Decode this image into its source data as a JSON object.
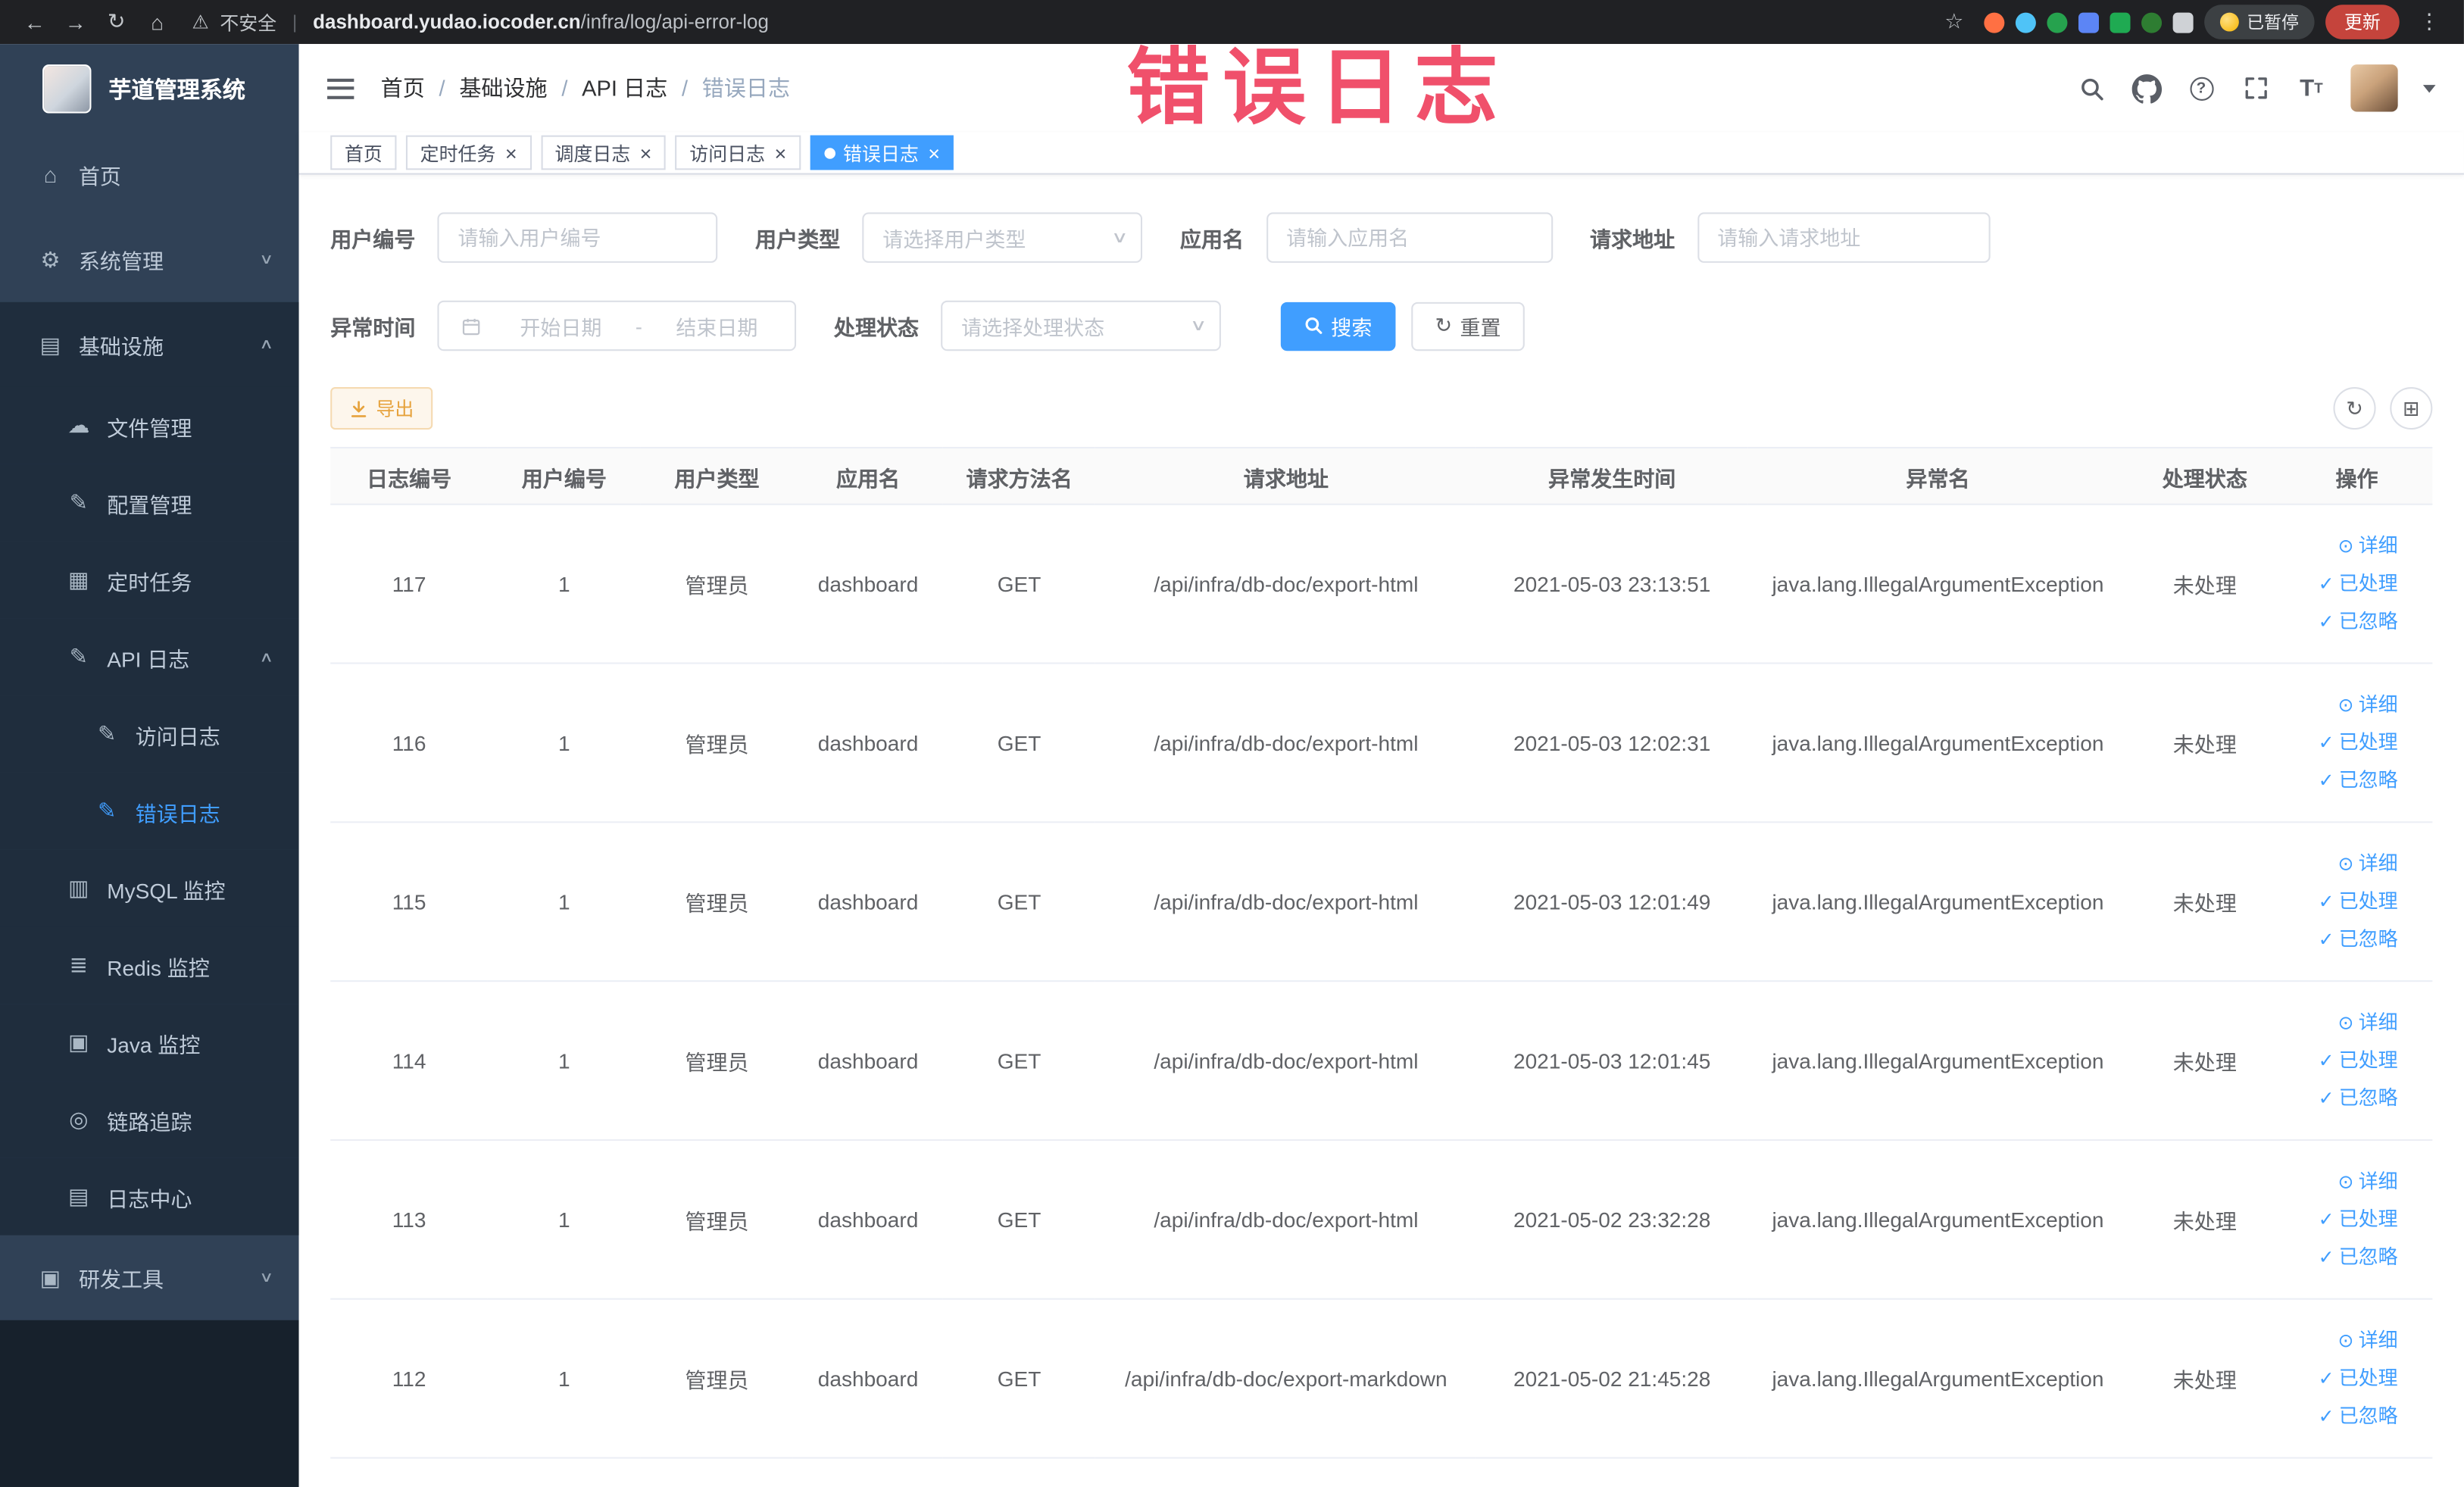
{
  "browser": {
    "security_label": "不安全",
    "url_separator": "|",
    "url_domain": "dashboard.yudao.iocoder.cn",
    "url_path": "/infra/log/api-error-log",
    "paused_badge": "已暂停",
    "update_button": "更新"
  },
  "annotation": {
    "title": "错误日志",
    "color": "#f0506b"
  },
  "icon_glyphs": {
    "back": "←",
    "forward": "→",
    "reload": "↻",
    "browser-home": "⌂",
    "star": "☆",
    "kebab": "⋮",
    "warning": "⚠",
    "home": "⌂",
    "gear": "⚙",
    "infra": "▤",
    "cloud": "☁",
    "edit": "✎",
    "task": "▦",
    "mysql": "▥",
    "redis": "≣",
    "java": "▣",
    "eye": "◎",
    "doc": "▤",
    "monitor": "▣",
    "chevron-up": "∧",
    "chevron-down": "∨",
    "close": "×",
    "refresh": "↻",
    "grid": "⊞",
    "eye-action": "⊙",
    "check": "✓"
  },
  "sidebar": {
    "logo_title": "芋道管理系统",
    "items": [
      {
        "key": "home",
        "label": "首页",
        "icon": "home",
        "level": 1
      },
      {
        "key": "system",
        "label": "系统管理",
        "icon": "gear",
        "level": 1,
        "arrow": "down"
      },
      {
        "key": "infrastructure",
        "label": "基础设施",
        "icon": "infra",
        "level": 1,
        "arrow": "up",
        "sub": true
      },
      {
        "key": "file-manage",
        "label": "文件管理",
        "icon": "cloud",
        "level": 2,
        "sub": true
      },
      {
        "key": "config-manage",
        "label": "配置管理",
        "icon": "edit",
        "level": 2,
        "sub": true
      },
      {
        "key": "scheduled-job",
        "label": "定时任务",
        "icon": "task",
        "level": 2,
        "sub": true
      },
      {
        "key": "api-log",
        "label": "API 日志",
        "icon": "edit",
        "level": 2,
        "arrow": "up",
        "sub": true
      },
      {
        "key": "access-log",
        "label": "访问日志",
        "icon": "edit",
        "level": 3,
        "sub": true
      },
      {
        "key": "error-log",
        "label": "错误日志",
        "icon": "edit",
        "level": 3,
        "sub": true,
        "active": true
      },
      {
        "key": "mysql-monitor",
        "label": "MySQL 监控",
        "icon": "mysql",
        "level": 2,
        "sub": true
      },
      {
        "key": "redis-monitor",
        "label": "Redis 监控",
        "icon": "redis",
        "level": 2,
        "sub": true
      },
      {
        "key": "java-monitor",
        "label": "Java 监控",
        "icon": "java",
        "level": 2,
        "sub": true
      },
      {
        "key": "trace",
        "label": "链路追踪",
        "icon": "eye",
        "level": 2,
        "sub": true
      },
      {
        "key": "log-center",
        "label": "日志中心",
        "icon": "doc",
        "level": 2,
        "sub": true
      },
      {
        "key": "dev-tools",
        "label": "研发工具",
        "icon": "monitor",
        "level": 1,
        "arrow": "down"
      }
    ]
  },
  "header": {
    "breadcrumb": [
      "首页",
      "基础设施",
      "API 日志",
      "错误日志"
    ],
    "breadcrumb_separator": "/"
  },
  "tabs": [
    {
      "key": "home",
      "label": "首页",
      "closable": false,
      "active": false
    },
    {
      "key": "scheduled-job",
      "label": "定时任务",
      "closable": true,
      "active": false
    },
    {
      "key": "job-log",
      "label": "调度日志",
      "closable": true,
      "active": false
    },
    {
      "key": "access-log",
      "label": "访问日志",
      "closable": true,
      "active": false
    },
    {
      "key": "error-log",
      "label": "错误日志",
      "closable": true,
      "active": true
    }
  ],
  "filters": {
    "user_id_label": "用户编号",
    "user_id_placeholder": "请输入用户编号",
    "user_type_label": "用户类型",
    "user_type_placeholder": "请选择用户类型",
    "app_name_label": "应用名",
    "app_name_placeholder": "请输入应用名",
    "request_url_label": "请求地址",
    "request_url_placeholder": "请输入请求地址",
    "exception_time_label": "异常时间",
    "start_date_placeholder": "开始日期",
    "range_separator": "-",
    "end_date_placeholder": "结束日期",
    "process_status_label": "处理状态",
    "process_status_placeholder": "请选择处理状态",
    "search_button": "搜索",
    "reset_button": "重置"
  },
  "toolbar": {
    "export_button": "导出"
  },
  "table": {
    "columns": [
      "日志编号",
      "用户编号",
      "用户类型",
      "应用名",
      "请求方法名",
      "请求地址",
      "异常发生时间",
      "异常名",
      "处理状态",
      "操作"
    ],
    "row_actions": [
      {
        "key": "detail",
        "label": "详细",
        "icon": "eye-action"
      },
      {
        "key": "processed",
        "label": "已处理",
        "icon": "check"
      },
      {
        "key": "ignored",
        "label": "已忽略",
        "icon": "check"
      }
    ],
    "rows": [
      {
        "id": "117",
        "user_id": "1",
        "user_type": "管理员",
        "app": "dashboard",
        "method": "GET",
        "url": "/api/infra/db-doc/export-html",
        "time": "2021-05-03 23:13:51",
        "exception": "java.lang.IllegalArgumentException",
        "status": "未处理"
      },
      {
        "id": "116",
        "user_id": "1",
        "user_type": "管理员",
        "app": "dashboard",
        "method": "GET",
        "url": "/api/infra/db-doc/export-html",
        "time": "2021-05-03 12:02:31",
        "exception": "java.lang.IllegalArgumentException",
        "status": "未处理"
      },
      {
        "id": "115",
        "user_id": "1",
        "user_type": "管理员",
        "app": "dashboard",
        "method": "GET",
        "url": "/api/infra/db-doc/export-html",
        "time": "2021-05-03 12:01:49",
        "exception": "java.lang.IllegalArgumentException",
        "status": "未处理"
      },
      {
        "id": "114",
        "user_id": "1",
        "user_type": "管理员",
        "app": "dashboard",
        "method": "GET",
        "url": "/api/infra/db-doc/export-html",
        "time": "2021-05-03 12:01:45",
        "exception": "java.lang.IllegalArgumentException",
        "status": "未处理"
      },
      {
        "id": "113",
        "user_id": "1",
        "user_type": "管理员",
        "app": "dashboard",
        "method": "GET",
        "url": "/api/infra/db-doc/export-html",
        "time": "2021-05-02 23:32:28",
        "exception": "java.lang.IllegalArgumentException",
        "status": "未处理"
      },
      {
        "id": "112",
        "user_id": "1",
        "user_type": "管理员",
        "app": "dashboard",
        "method": "GET",
        "url": "/api/infra/db-doc/export-markdown",
        "time": "2021-05-02 21:45:28",
        "exception": "java.lang.IllegalArgumentException",
        "status": "未处理"
      }
    ]
  },
  "accent_colors": {
    "primary": "#409eff",
    "warning": "#e6a23c",
    "sidebar_bg": "#304156",
    "submenu_bg": "#1f2d3d"
  }
}
